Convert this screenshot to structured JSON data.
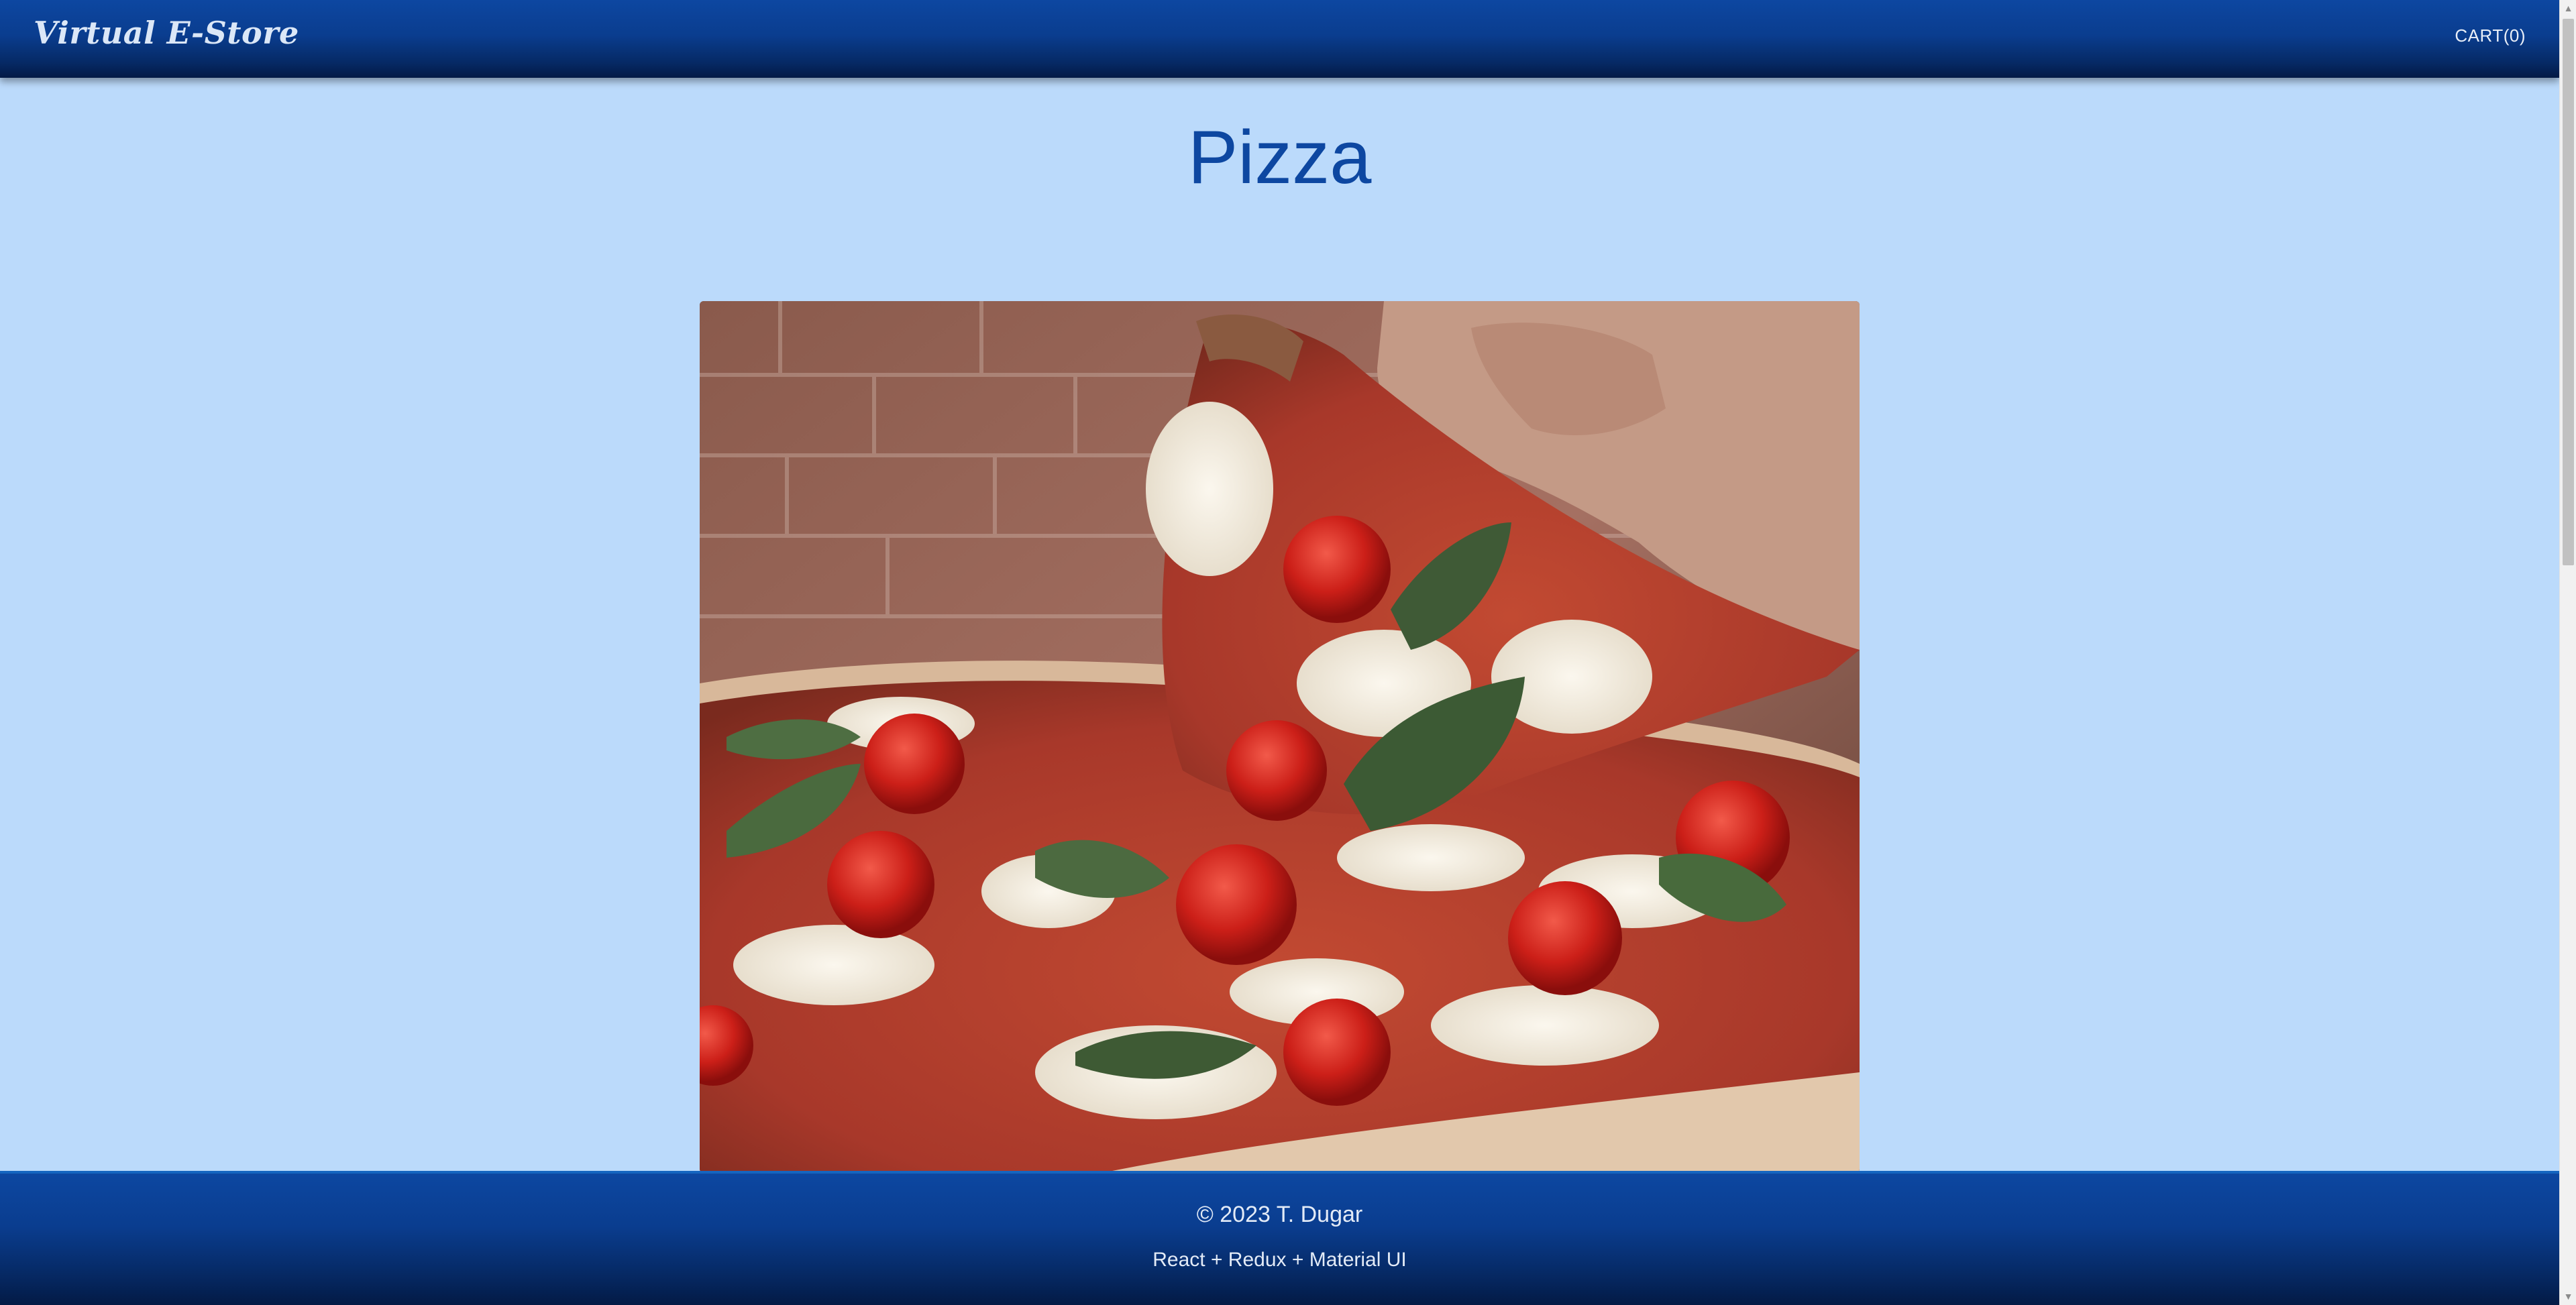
{
  "header": {
    "brand": "Virtual E-Store",
    "cart_label": "CART(0)"
  },
  "main": {
    "title": "Pizza"
  },
  "footer": {
    "copyright": "© 2023 T. Dugar",
    "stack": "React + Redux + Material UI"
  },
  "colors": {
    "background": "#bbdafb",
    "primary": "#0d47a1",
    "bar_dark": "#031a45"
  },
  "icons": {
    "scroll_up": "scroll-up-arrow-icon",
    "scroll_down": "scroll-down-arrow-icon"
  }
}
